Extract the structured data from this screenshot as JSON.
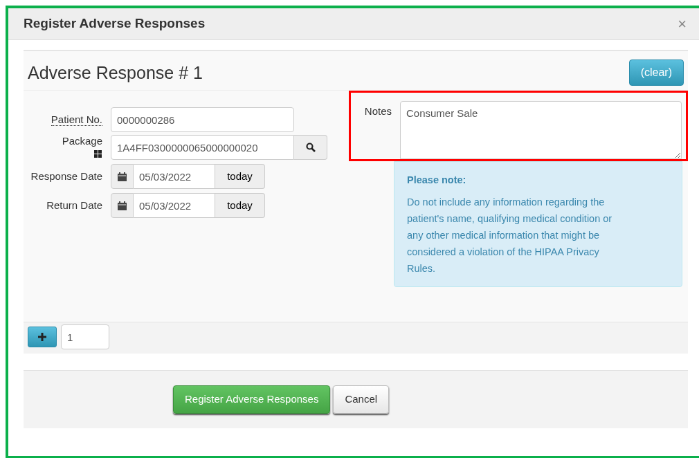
{
  "modal": {
    "title": "Register Adverse Responses",
    "close": "×"
  },
  "response": {
    "heading": "Adverse Response # 1",
    "clear_button": "(clear)",
    "fields": [
      {
        "kind": "text",
        "label": "Patient No.",
        "value": "0000000286"
      },
      {
        "kind": "search",
        "label": "Package",
        "value": "1A4FF0300000065000000020"
      },
      {
        "kind": "date",
        "label": "Response Date",
        "value": "05/03/2022",
        "button": "today"
      },
      {
        "kind": "date",
        "label": "Return Date",
        "value": "05/03/2022",
        "button": "today"
      }
    ],
    "notes": {
      "label": "Notes",
      "value": "Consumer Sale",
      "highlighted": true
    },
    "alert": {
      "title": "Please note:",
      "text": "Do not include any information regarding the patient's name, qualifying medical condition or any other medical information that might be considered a violation of the HIPAA Privacy Rules."
    }
  },
  "add_row": {
    "count": "1"
  },
  "footer": {
    "buttons": [
      {
        "label": "Register Adverse Responses",
        "kind": "primary"
      },
      {
        "label": "Cancel",
        "kind": "default"
      }
    ]
  }
}
